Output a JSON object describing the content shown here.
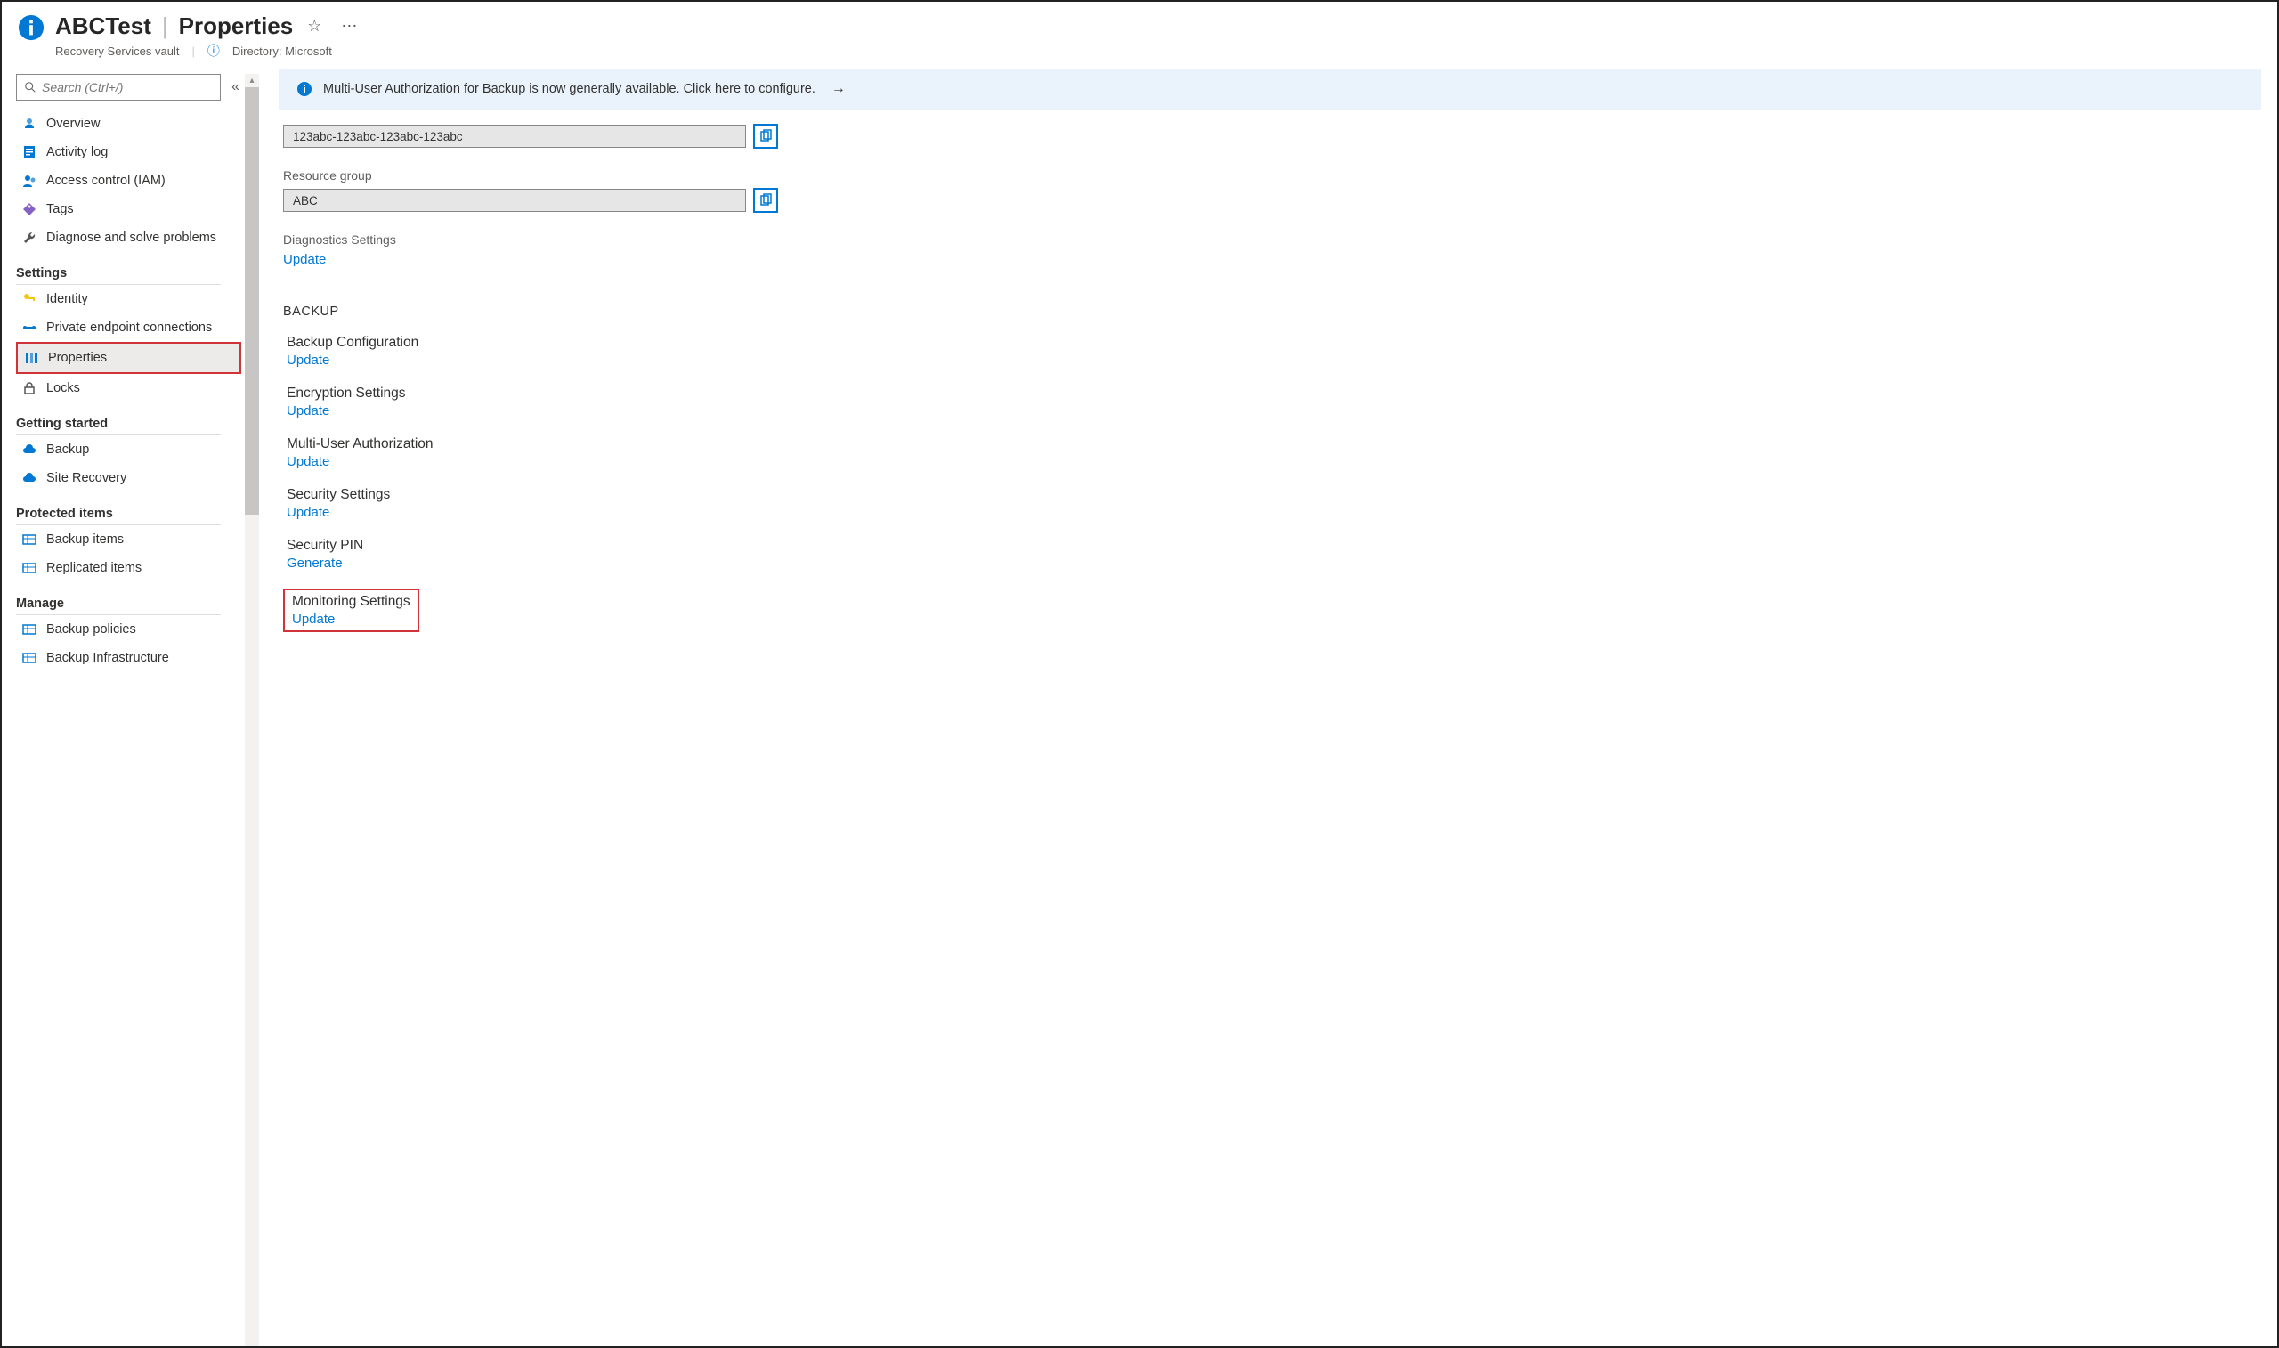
{
  "header": {
    "title": "ABCTest",
    "page": "Properties",
    "subtitle": "Recovery Services vault",
    "directory_label": "Directory: Microsoft"
  },
  "sidebar": {
    "search_placeholder": "Search (Ctrl+/)",
    "items_top": [
      {
        "label": "Overview",
        "icon": "overview"
      },
      {
        "label": "Activity log",
        "icon": "log"
      },
      {
        "label": "Access control (IAM)",
        "icon": "iam"
      },
      {
        "label": "Tags",
        "icon": "tag"
      },
      {
        "label": "Diagnose and solve problems",
        "icon": "wrench"
      }
    ],
    "groups": [
      {
        "label": "Settings",
        "items": [
          {
            "label": "Identity",
            "icon": "key"
          },
          {
            "label": "Private endpoint connections",
            "icon": "endpoint"
          },
          {
            "label": "Properties",
            "icon": "props",
            "selected": true,
            "highlight": true
          },
          {
            "label": "Locks",
            "icon": "lock"
          }
        ]
      },
      {
        "label": "Getting started",
        "items": [
          {
            "label": "Backup",
            "icon": "cloud"
          },
          {
            "label": "Site Recovery",
            "icon": "cloud"
          }
        ]
      },
      {
        "label": "Protected items",
        "items": [
          {
            "label": "Backup items",
            "icon": "grid"
          },
          {
            "label": "Replicated items",
            "icon": "grid"
          }
        ]
      },
      {
        "label": "Manage",
        "items": [
          {
            "label": "Backup policies",
            "icon": "grid"
          },
          {
            "label": "Backup Infrastructure",
            "icon": "grid"
          }
        ]
      }
    ]
  },
  "content": {
    "banner": "Multi-User Authorization for Backup is now generally available. Click here to configure.",
    "field1_value": "123abc-123abc-123abc-123abc",
    "rg_label": "Resource group",
    "rg_value": "ABC",
    "diag_label": "Diagnostics Settings",
    "diag_action": "Update",
    "backup_section": "BACKUP",
    "props": [
      {
        "label": "Backup Configuration",
        "action": "Update"
      },
      {
        "label": "Encryption Settings",
        "action": "Update"
      },
      {
        "label": "Multi-User Authorization",
        "action": "Update"
      },
      {
        "label": "Security Settings",
        "action": "Update"
      },
      {
        "label": "Security PIN",
        "action": "Generate"
      },
      {
        "label": "Monitoring Settings",
        "action": "Update",
        "highlight": true
      }
    ]
  }
}
